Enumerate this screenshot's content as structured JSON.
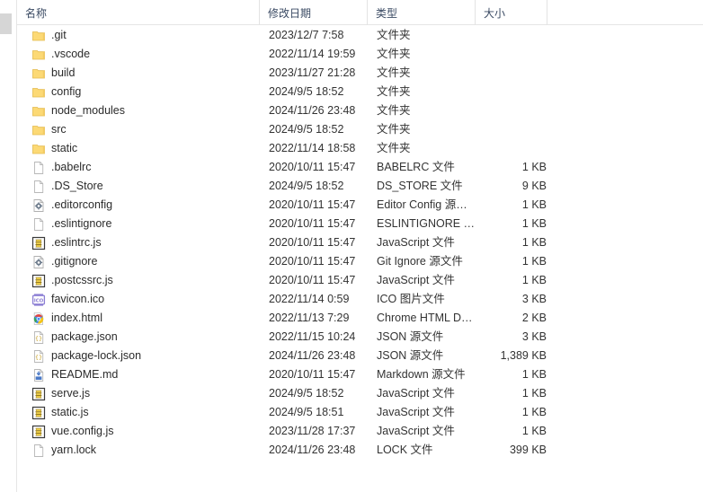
{
  "window": {
    "kind": "file-explorer-list-view"
  },
  "columns": [
    {
      "key": "name",
      "label": "名称",
      "sorted": true,
      "sort_direction": "ascending"
    },
    {
      "key": "date",
      "label": "修改日期",
      "sorted": false,
      "sort_direction": ""
    },
    {
      "key": "type",
      "label": "类型",
      "sorted": false,
      "sort_direction": ""
    },
    {
      "key": "size",
      "label": "大小",
      "sorted": false,
      "sort_direction": ""
    }
  ],
  "colors": {
    "folder": "#fcd975",
    "folder_edge": "#e3ba4d",
    "header_text": "#3a4a63",
    "row_text": "#2b2b2b",
    "grid_line": "#e3e3e3",
    "scroll_thumb": "#d6d6d6",
    "js_yellow": "#f0d04a",
    "ico_purple": "#8c7fd4",
    "chrome_red": "#e8453c",
    "markdown_blue": "#4a79c7"
  },
  "files": [
    {
      "name": ".git",
      "icon": "folder-icon",
      "date": "2023/12/7 7:58",
      "type": "文件夹",
      "size": ""
    },
    {
      "name": ".vscode",
      "icon": "folder-icon",
      "date": "2022/11/14 19:59",
      "type": "文件夹",
      "size": ""
    },
    {
      "name": "build",
      "icon": "folder-icon",
      "date": "2023/11/27 21:28",
      "type": "文件夹",
      "size": ""
    },
    {
      "name": "config",
      "icon": "folder-icon",
      "date": "2024/9/5 18:52",
      "type": "文件夹",
      "size": ""
    },
    {
      "name": "node_modules",
      "icon": "folder-icon",
      "date": "2024/11/26 23:48",
      "type": "文件夹",
      "size": ""
    },
    {
      "name": "src",
      "icon": "folder-icon",
      "date": "2024/9/5 18:52",
      "type": "文件夹",
      "size": ""
    },
    {
      "name": "static",
      "icon": "folder-icon",
      "date": "2022/11/14 18:58",
      "type": "文件夹",
      "size": ""
    },
    {
      "name": ".babelrc",
      "icon": "blank-file-icon",
      "date": "2020/10/11 15:47",
      "type": "BABELRC 文件",
      "size": "1 KB"
    },
    {
      "name": ".DS_Store",
      "icon": "blank-file-icon",
      "date": "2024/9/5 18:52",
      "type": "DS_STORE 文件",
      "size": "9 KB"
    },
    {
      "name": ".editorconfig",
      "icon": "gear-file-icon",
      "date": "2020/10/11 15:47",
      "type": "Editor Config 源…",
      "size": "1 KB"
    },
    {
      "name": ".eslintignore",
      "icon": "blank-file-icon",
      "date": "2020/10/11 15:47",
      "type": "ESLINTIGNORE …",
      "size": "1 KB"
    },
    {
      "name": ".eslintrc.js",
      "icon": "javascript-icon",
      "date": "2020/10/11 15:47",
      "type": "JavaScript 文件",
      "size": "1 KB"
    },
    {
      "name": ".gitignore",
      "icon": "gear-file-icon",
      "date": "2020/10/11 15:47",
      "type": "Git Ignore 源文件",
      "size": "1 KB"
    },
    {
      "name": ".postcssrc.js",
      "icon": "javascript-icon",
      "date": "2020/10/11 15:47",
      "type": "JavaScript 文件",
      "size": "1 KB"
    },
    {
      "name": "favicon.ico",
      "icon": "ico-image-icon",
      "date": "2022/11/14 0:59",
      "type": "ICO 图片文件",
      "size": "3 KB"
    },
    {
      "name": "index.html",
      "icon": "chrome-html-icon",
      "date": "2022/11/13 7:29",
      "type": "Chrome HTML D…",
      "size": "2 KB"
    },
    {
      "name": "package.json",
      "icon": "json-file-icon",
      "date": "2022/11/15 10:24",
      "type": "JSON 源文件",
      "size": "3 KB"
    },
    {
      "name": "package-lock.json",
      "icon": "json-file-icon",
      "date": "2024/11/26 23:48",
      "type": "JSON 源文件",
      "size": "1,389 KB"
    },
    {
      "name": "README.md",
      "icon": "markdown-file-icon",
      "date": "2020/10/11 15:47",
      "type": "Markdown 源文件",
      "size": "1 KB"
    },
    {
      "name": "serve.js",
      "icon": "javascript-icon",
      "date": "2024/9/5 18:52",
      "type": "JavaScript 文件",
      "size": "1 KB"
    },
    {
      "name": "static.js",
      "icon": "javascript-icon",
      "date": "2024/9/5 18:51",
      "type": "JavaScript 文件",
      "size": "1 KB"
    },
    {
      "name": "vue.config.js",
      "icon": "javascript-icon",
      "date": "2023/11/28 17:37",
      "type": "JavaScript 文件",
      "size": "1 KB"
    },
    {
      "name": "yarn.lock",
      "icon": "blank-file-icon",
      "date": "2024/11/26 23:48",
      "type": "LOCK 文件",
      "size": "399 KB"
    }
  ]
}
